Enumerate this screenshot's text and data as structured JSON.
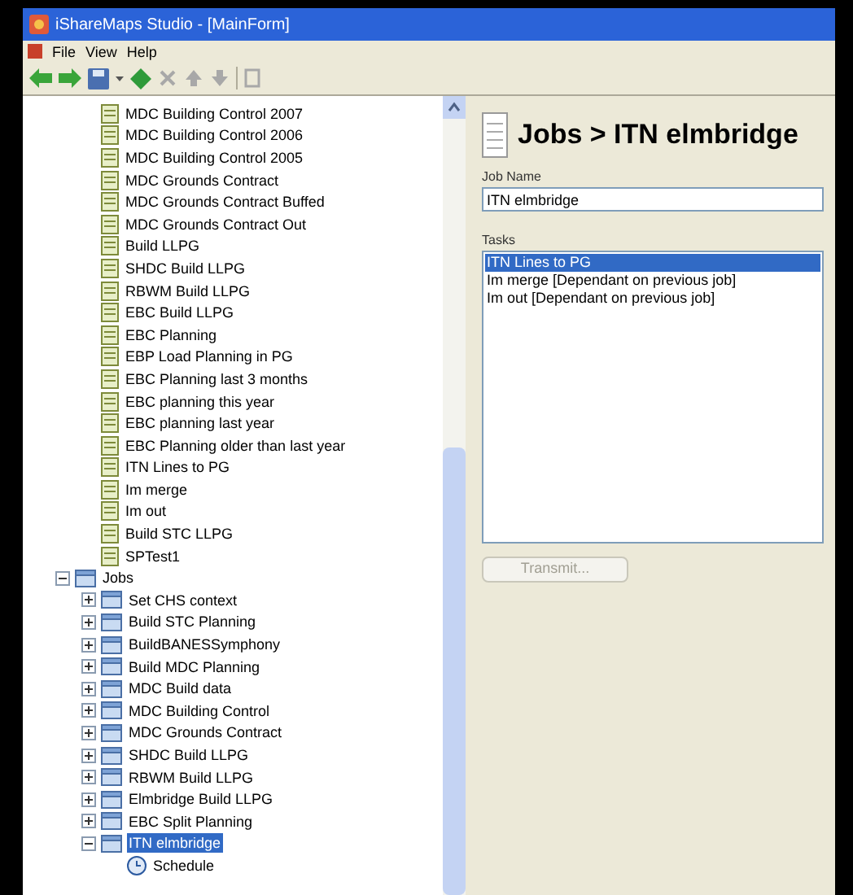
{
  "window": {
    "title": "iShareMaps Studio - [MainForm]"
  },
  "menu": [
    "File",
    "View",
    "Help"
  ],
  "tree": {
    "scrolled_children": [
      {
        "label": "MDC Building Control 2007",
        "selected": false
      },
      {
        "label": "MDC Building Control 2006",
        "selected": false
      },
      {
        "label": "MDC Building Control 2005",
        "selected": false
      },
      {
        "label": "MDC Grounds Contract",
        "selected": false
      },
      {
        "label": "MDC Grounds Contract Buffed",
        "selected": false
      },
      {
        "label": "MDC Grounds Contract Out",
        "selected": false
      },
      {
        "label": "Build LLPG",
        "selected": false
      },
      {
        "label": "SHDC Build LLPG",
        "selected": false
      },
      {
        "label": "RBWM Build LLPG",
        "selected": false
      },
      {
        "label": "EBC Build LLPG",
        "selected": false
      },
      {
        "label": "EBC Planning",
        "selected": false
      },
      {
        "label": "EBP Load Planning in PG",
        "selected": false
      },
      {
        "label": "EBC Planning last 3 months",
        "selected": false
      },
      {
        "label": "EBC planning this year",
        "selected": false
      },
      {
        "label": "EBC planning last year",
        "selected": false
      },
      {
        "label": "EBC Planning older than last year",
        "selected": false
      },
      {
        "label": "ITN Lines to PG",
        "selected": false
      },
      {
        "label": "Im merge",
        "selected": false
      },
      {
        "label": "Im out",
        "selected": false
      },
      {
        "label": "Build STC LLPG",
        "selected": false
      },
      {
        "label": "SPTest1",
        "selected": false
      }
    ],
    "nodes": [
      {
        "label": "Jobs",
        "selected": false,
        "expanded": true,
        "children": [
          {
            "label": "Set CHS context",
            "selected": false,
            "expanded": false
          },
          {
            "label": "Build STC Planning",
            "selected": false,
            "expanded": false
          },
          {
            "label": "BuildBANESSymphony",
            "selected": false,
            "expanded": false
          },
          {
            "label": "Build MDC Planning",
            "selected": false,
            "expanded": false
          },
          {
            "label": "MDC Build data",
            "selected": false,
            "expanded": false
          },
          {
            "label": "MDC Building Control",
            "selected": false,
            "expanded": false
          },
          {
            "label": "MDC Grounds Contract",
            "selected": false,
            "expanded": false
          },
          {
            "label": "SHDC Build LLPG",
            "selected": false,
            "expanded": false
          },
          {
            "label": "RBWM Build LLPG",
            "selected": false,
            "expanded": false
          },
          {
            "label": "Elmbridge Build LLPG",
            "selected": false,
            "expanded": false
          },
          {
            "label": "EBC Split Planning",
            "selected": false,
            "expanded": false
          },
          {
            "label": "ITN elmbridge",
            "selected": true,
            "expanded": true,
            "children": [
              {
                "label": "Schedule",
                "selected": false
              }
            ]
          }
        ]
      }
    ]
  },
  "detail": {
    "heading": "Jobs > ITN elmbridge",
    "job_name": {
      "label": "Job Name",
      "value": "ITN elmbridge"
    },
    "tasks": {
      "label": "Tasks",
      "items": [
        {
          "label": "ITN Lines to PG",
          "selected": true
        },
        {
          "label": "Im merge [Dependant on previous job]",
          "selected": false
        },
        {
          "label": "Im out [Dependant on previous job]",
          "selected": false
        }
      ]
    },
    "button": {
      "label": "Transmit...",
      "disabled": true
    }
  }
}
